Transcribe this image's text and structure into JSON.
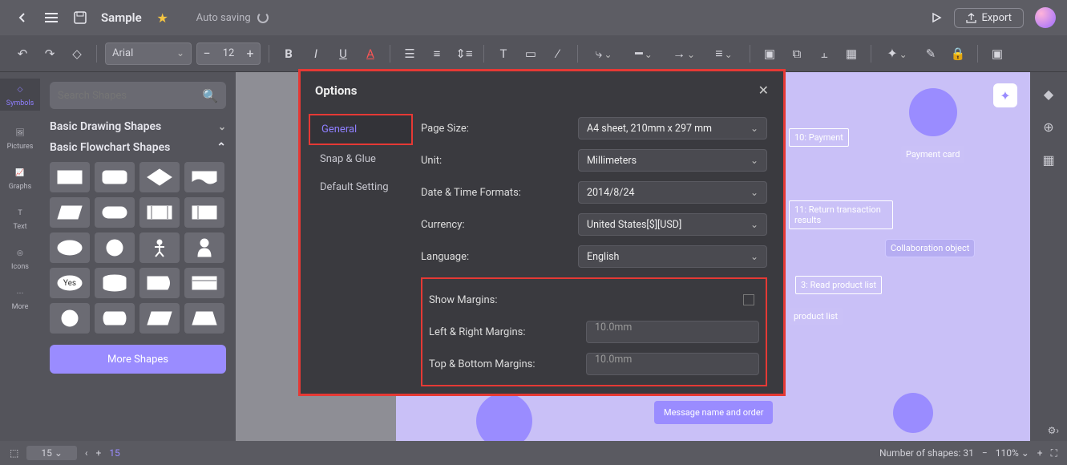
{
  "topbar": {
    "title": "Sample",
    "autosave": "Auto saving",
    "export": "Export"
  },
  "toolbar": {
    "font": "Arial",
    "font_size": "12"
  },
  "leftrail": {
    "items": [
      "Symbols",
      "Pictures",
      "Graphs",
      "Text",
      "Icons",
      "More"
    ]
  },
  "sidebar": {
    "search_placeholder": "Search Shapes",
    "cat1": "Basic Drawing Shapes",
    "cat2": "Basic Flowchart Shapes",
    "yes": "Yes",
    "more": "More Shapes"
  },
  "bottombar": {
    "page_size": "15",
    "page_num": "15",
    "shapes_label": "Number of shapes: 31",
    "zoom": "110%"
  },
  "canvas": {
    "n_payment": "10: Payment",
    "n_card": "Payment card",
    "n_return": "11: Return transaction results",
    "n_collab": "Collaboration object",
    "n_read": "3: Read product list",
    "n_prodlist": "product list",
    "n_msg": "Message name and order"
  },
  "modal": {
    "title": "Options",
    "tabs": {
      "general": "General",
      "snap": "Snap & Glue",
      "default": "Default Setting"
    },
    "labels": {
      "page_size": "Page Size:",
      "unit": "Unit:",
      "date": "Date & Time Formats:",
      "currency": "Currency:",
      "language": "Language:",
      "show_margins": "Show Margins:",
      "lr_margins": "Left & Right Margins:",
      "tb_margins": "Top & Bottom Margins:"
    },
    "values": {
      "page_size": "A4 sheet, 210mm x 297 mm",
      "unit": "Millimeters",
      "date": "2014/8/24",
      "currency": "United States[$][USD]",
      "language": "English",
      "lr_margins": "10.0mm",
      "tb_margins": "10.0mm"
    }
  }
}
